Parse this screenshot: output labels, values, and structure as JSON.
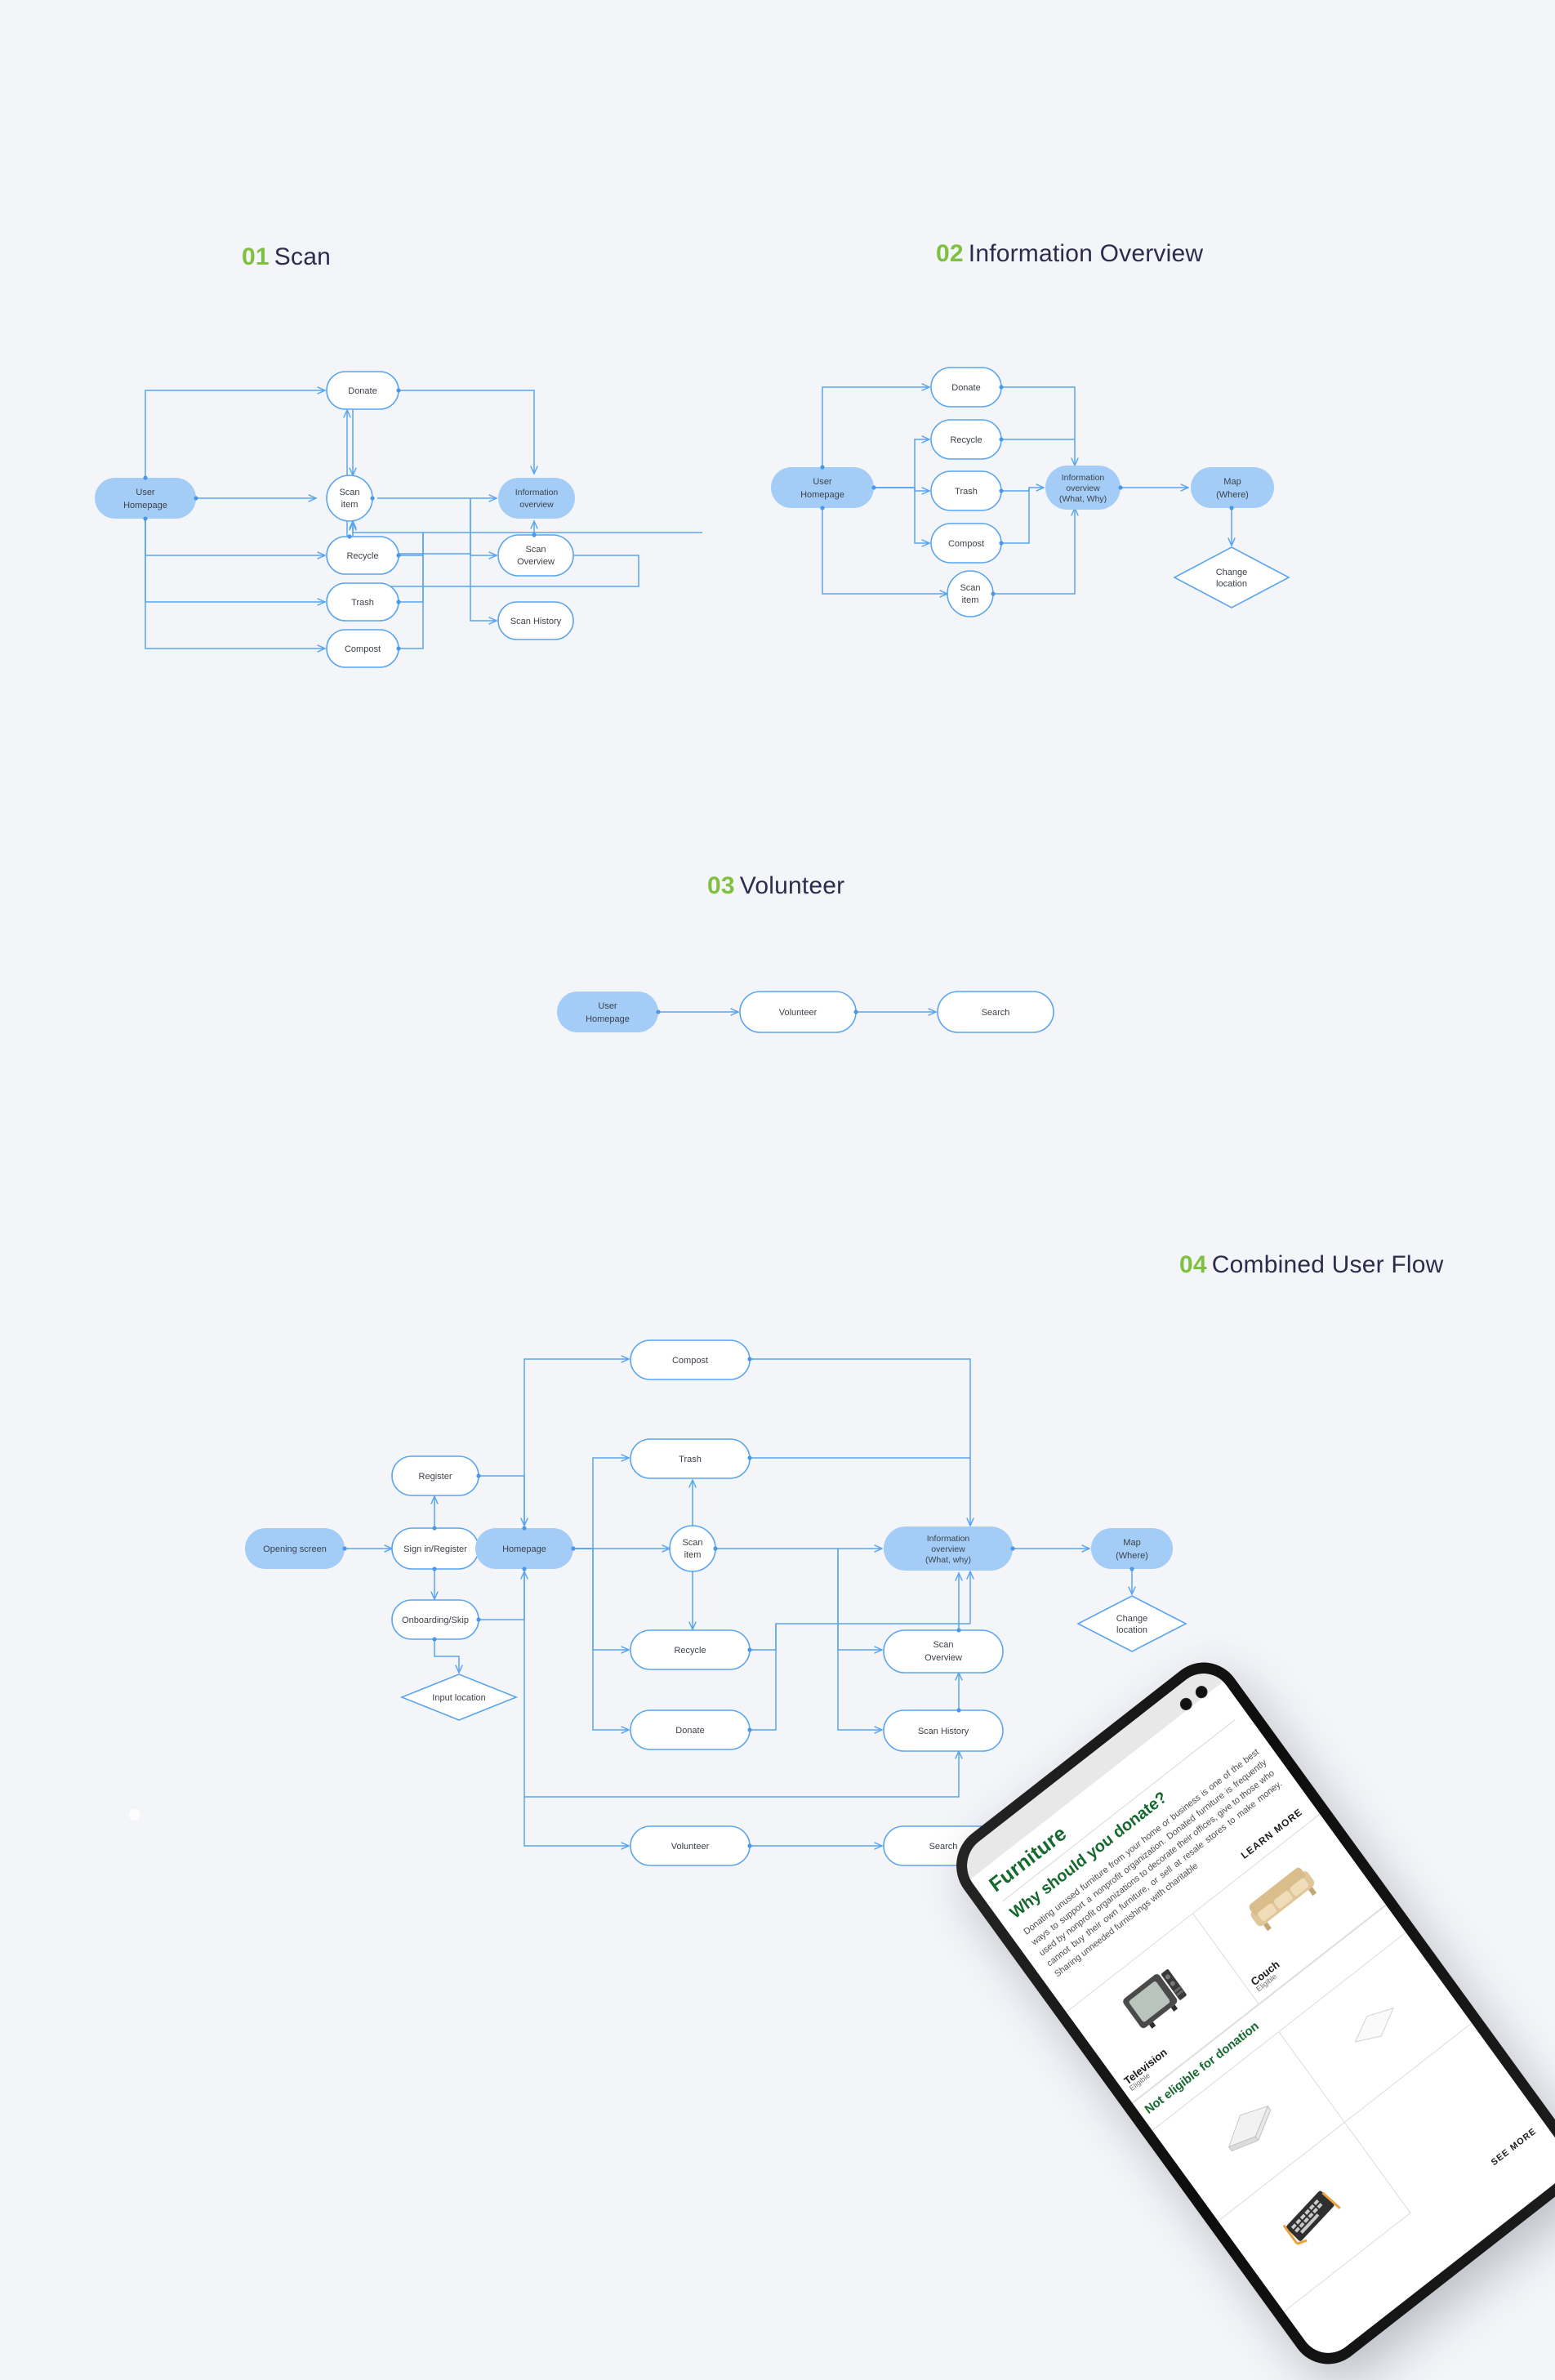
{
  "background_color": "#f4f5f9",
  "accent_green": "#7ec13e",
  "heading_color": "#2b2d4c",
  "node_blue_fill": "#a3cdf7",
  "edge_blue": "#59a5f0",
  "sections": [
    {
      "number": "01",
      "title": "Scan"
    },
    {
      "number": "02",
      "title": "Information Overview"
    },
    {
      "number": "03",
      "title": "Volunteer"
    },
    {
      "number": "04",
      "title": "Combined User Flow"
    }
  ],
  "flow_scan": {
    "nodes": [
      {
        "id": "user_homepage",
        "label_1": "User",
        "label_2": "Homepage",
        "shape": "pill",
        "accent": true
      },
      {
        "id": "donate",
        "label_1": "Donate",
        "shape": "pill",
        "accent": false
      },
      {
        "id": "scan_item",
        "label_1": "Scan",
        "label_2": "item",
        "shape": "circle",
        "accent": false
      },
      {
        "id": "information_overview",
        "label_1": "Information",
        "label_2": "overview",
        "shape": "pill",
        "accent": true
      },
      {
        "id": "recycle",
        "label_1": "Recycle",
        "shape": "pill",
        "accent": false
      },
      {
        "id": "scan_overview",
        "label_1": "Scan",
        "label_2": "Overview",
        "shape": "pill",
        "accent": false
      },
      {
        "id": "trash",
        "label_1": "Trash",
        "shape": "pill",
        "accent": false
      },
      {
        "id": "scan_history",
        "label_1": "Scan History",
        "shape": "pill",
        "accent": false
      },
      {
        "id": "compost",
        "label_1": "Compost",
        "shape": "pill",
        "accent": false
      }
    ]
  },
  "flow_information_overview": {
    "nodes": [
      {
        "id": "user_homepage",
        "label_1": "User",
        "label_2": "Homepage",
        "shape": "pill",
        "accent": true
      },
      {
        "id": "donate",
        "label_1": "Donate",
        "shape": "pill",
        "accent": false
      },
      {
        "id": "recycle",
        "label_1": "Recycle",
        "shape": "pill",
        "accent": false
      },
      {
        "id": "trash",
        "label_1": "Trash",
        "shape": "pill",
        "accent": false
      },
      {
        "id": "compost",
        "label_1": "Compost",
        "shape": "pill",
        "accent": false
      },
      {
        "id": "scan_item",
        "label_1": "Scan",
        "label_2": "item",
        "shape": "circle",
        "accent": false
      },
      {
        "id": "information_overview",
        "label_1": "Information",
        "label_2": "overview",
        "label_3": "(What, Why)",
        "shape": "pill",
        "accent": true
      },
      {
        "id": "map",
        "label_1": "Map",
        "label_2": "(Where)",
        "shape": "pill",
        "accent": true
      },
      {
        "id": "change_location",
        "label_1": "Change",
        "label_2": "location",
        "shape": "diamond",
        "accent": false
      }
    ]
  },
  "flow_volunteer": {
    "nodes": [
      {
        "id": "user_homepage",
        "label_1": "User",
        "label_2": "Homepage",
        "shape": "pill",
        "accent": true
      },
      {
        "id": "volunteer",
        "label_1": "Volunteer",
        "shape": "pill",
        "accent": false
      },
      {
        "id": "search",
        "label_1": "Search",
        "shape": "pill",
        "accent": false
      }
    ]
  },
  "flow_combined": {
    "nodes": [
      {
        "id": "opening_screen",
        "label_1": "Opening screen",
        "shape": "pill",
        "accent": true
      },
      {
        "id": "register",
        "label_1": "Register",
        "shape": "pill",
        "accent": false
      },
      {
        "id": "sign_in_register",
        "label_1": "Sign in/Register",
        "shape": "pill",
        "accent": false
      },
      {
        "id": "onboarding_skip",
        "label_1": "Onboarding/Skip",
        "shape": "pill",
        "accent": false
      },
      {
        "id": "input_location",
        "label_1": "Input location",
        "shape": "diamond",
        "accent": false
      },
      {
        "id": "homepage",
        "label_1": "Homepage",
        "shape": "pill",
        "accent": true
      },
      {
        "id": "compost",
        "label_1": "Compost",
        "shape": "pill",
        "accent": false
      },
      {
        "id": "trash",
        "label_1": "Trash",
        "shape": "pill",
        "accent": false
      },
      {
        "id": "scan_item",
        "label_1": "Scan",
        "label_2": "item",
        "shape": "circle",
        "accent": false
      },
      {
        "id": "recycle",
        "label_1": "Recycle",
        "shape": "pill",
        "accent": false
      },
      {
        "id": "donate",
        "label_1": "Donate",
        "shape": "pill",
        "accent": false
      },
      {
        "id": "information_overview",
        "label_1": "Information",
        "label_2": "overview",
        "label_3": "(What, why)",
        "shape": "pill",
        "accent": true
      },
      {
        "id": "map",
        "label_1": "Map",
        "label_2": "(Where)",
        "shape": "pill",
        "accent": true
      },
      {
        "id": "change_location",
        "label_1": "Change",
        "label_2": "location",
        "shape": "diamond",
        "accent": false
      },
      {
        "id": "scan_overview",
        "label_1": "Scan",
        "label_2": "Overview",
        "shape": "pill",
        "accent": false
      },
      {
        "id": "scan_history",
        "label_1": "Scan History",
        "shape": "pill",
        "accent": false
      },
      {
        "id": "volunteer",
        "label_1": "Volunteer",
        "shape": "pill",
        "accent": false
      },
      {
        "id": "search",
        "label_1": "Search",
        "shape": "pill",
        "accent": false
      }
    ]
  },
  "phone_mockup": {
    "screen_title": "Furniture",
    "screen_subtitle": "Why should you donate?",
    "screen_body": "Donating unused furniture from your home or business is one of the best ways to support a nonprofit organization. Donated furniture is frequently used by nonprofit organizations to decorate their offices, give to those who cannot buy their own furniture, or sell at resale stores to make money. Sharing unneeded furnishings with charitable",
    "learn_more": "LEARN MORE",
    "see_more": "SEE MORE",
    "not_eligible_label": "Not eligible for donation",
    "eligible_items": [
      {
        "name": "Television",
        "status": "Eligible",
        "icon": "television-icon"
      },
      {
        "name": "Couch",
        "status": "Eligible",
        "icon": "couch-icon"
      }
    ],
    "ineligible_items": [
      {
        "icon": "mattress-icon"
      },
      {
        "icon": "pillow-icon"
      },
      {
        "icon": "keyboard-icon"
      }
    ]
  }
}
